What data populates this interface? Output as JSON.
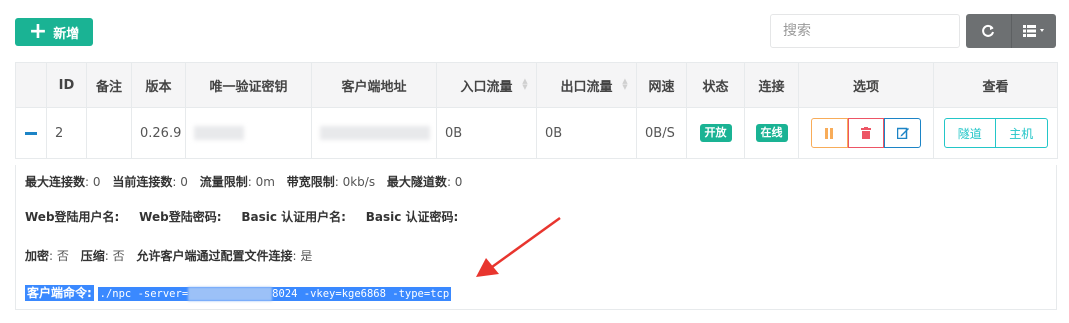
{
  "toolbar": {
    "add_label": "新增",
    "search_placeholder": "搜索",
    "refresh_icon": "refresh-icon",
    "list_icon": "list-icon"
  },
  "table": {
    "headers": [
      "",
      "ID",
      "备注",
      "版本",
      "唯一验证密钥",
      "客户端地址",
      "入口流量",
      "出口流量",
      "网速",
      "状态",
      "连接",
      "选项",
      "查看"
    ],
    "row": {
      "id": "2",
      "remark": "",
      "version": "0.26.9",
      "inlet_flow": "0B",
      "export_flow": "0B",
      "speed": "0B/S",
      "status": "开放",
      "connection": "在线",
      "view_tunnel": "隧道",
      "view_host": "主机"
    },
    "colors": {
      "accent": "#1ab394",
      "warning": "#f8ac59",
      "danger": "#ed5565",
      "primary": "#1c84c6",
      "info": "#23c6c8"
    }
  },
  "detail": {
    "max_conn_label": "最大连接数",
    "max_conn": "0",
    "cur_conn_label": "当前连接数",
    "cur_conn": "0",
    "flow_limit_label": "流量限制",
    "flow_limit": "0m",
    "rate_limit_label": "带宽限制",
    "rate_limit": "0kb/s",
    "max_tunnel_label": "最大隧道数",
    "max_tunnel": "0",
    "web_user_label": "Web登陆用户名:",
    "web_pass_label": "Web登陆密码:",
    "basic_user_label": "Basic 认证用户名:",
    "basic_pass_label": "Basic 认证密码:",
    "crypt_label": "加密",
    "crypt": "否",
    "compress_label": "压缩",
    "compress": "否",
    "config_conn_label": "允许客户端通过配置文件连接",
    "config_conn": "是",
    "cmd_label": "客户端命令:",
    "cmd_prefix": "./npc -server=",
    "cmd_suffix": "8024 -vkey=kge6868 -type=tcp"
  }
}
